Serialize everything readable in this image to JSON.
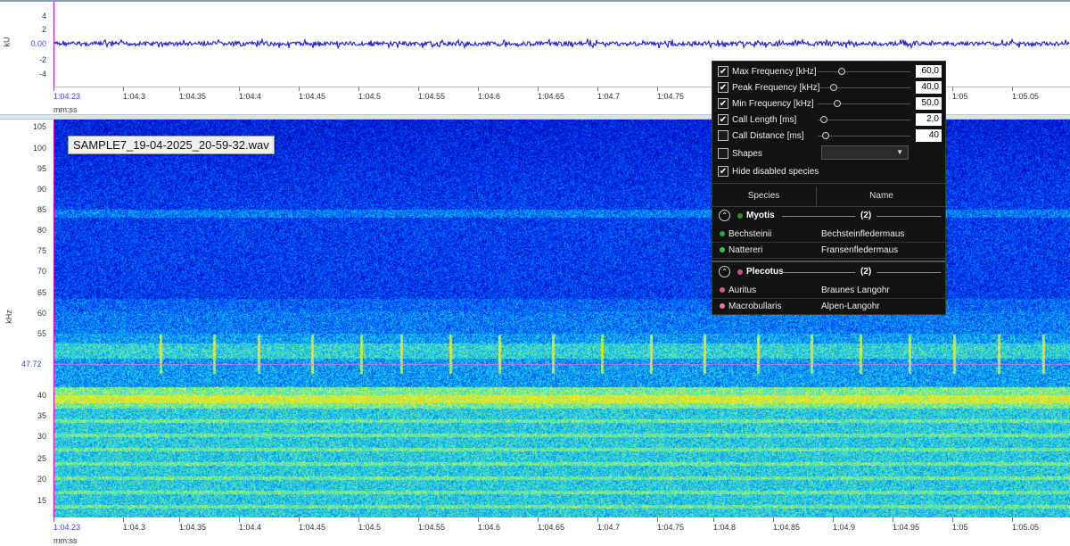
{
  "waveform": {
    "y_unit": "kU",
    "y_ticks": [
      "4",
      "2",
      "0.00",
      "-2",
      "-4"
    ],
    "x_unit": "mm:ss",
    "x_ticks": [
      "1:04.23",
      "1:04.3",
      "1:04.35",
      "1:04.4",
      "1:04.45",
      "1:04.5",
      "1:04.55",
      "1:04.6",
      "1:04.65",
      "1:04.7",
      "1:04.75",
      "1:05",
      "1:05.05"
    ]
  },
  "spectrogram": {
    "file_label": "SAMPLE7_19-04-2025_20-59-32.wav",
    "y_unit": "kHz",
    "y_ticks": [
      "105",
      "100",
      "95",
      "90",
      "85",
      "80",
      "75",
      "70",
      "65",
      "60",
      "55",
      "40",
      "35",
      "30",
      "25",
      "20",
      "15"
    ],
    "cursor_freq": "47.72",
    "x_unit": "mm:ss",
    "x_ticks": [
      "1:04.23",
      "1:04.3",
      "1:04.35",
      "1:04.4",
      "1:04.45",
      "1:04.5",
      "1:04.55",
      "1:04.6",
      "1:04.65",
      "1:04.7",
      "1:04.75",
      "1:04.8",
      "1:04.85",
      "1:04.9",
      "1:04.95",
      "1:05",
      "1:05.05"
    ]
  },
  "filter_panel": {
    "params": [
      {
        "label": "Max Frequency [kHz]",
        "checked": true,
        "value": "60,0",
        "level": 0.22
      },
      {
        "label": "Peak Frequency [kHz]",
        "checked": true,
        "value": "40,0",
        "level": 0.13
      },
      {
        "label": "Min Frequency [kHz]",
        "checked": true,
        "value": "50,0",
        "level": 0.17
      },
      {
        "label": "Call Length [ms]",
        "checked": true,
        "value": "2,0",
        "level": 0.03
      },
      {
        "label": "Call Distance [ms]",
        "checked": false,
        "value": "40",
        "level": 0.05
      }
    ],
    "shapes_label": "Shapes",
    "shapes_checked": false,
    "hide_disabled_label": "Hide disabled species",
    "hide_disabled_checked": true,
    "columns": {
      "species": "Species",
      "name": "Name"
    },
    "groups": [
      {
        "name": "Myotis",
        "count": "(2)",
        "color": "#2e8b3a",
        "items": [
          {
            "species": "Bechsteinii",
            "name": "Bechsteinfledermaus",
            "color": "#34a04a"
          },
          {
            "species": "Nattereri",
            "name": "Fransenfledermaus",
            "color": "#3cc050"
          }
        ]
      },
      {
        "name": "Plecotus",
        "count": "(2)",
        "color": "#d04a9a",
        "items": [
          {
            "species": "Auritus",
            "name": "Braunes Langohr",
            "color": "#d05a8a"
          },
          {
            "species": "Macrobullaris",
            "name": "Alpen-Langohr",
            "color": "#e07aa8"
          }
        ]
      }
    ]
  }
}
